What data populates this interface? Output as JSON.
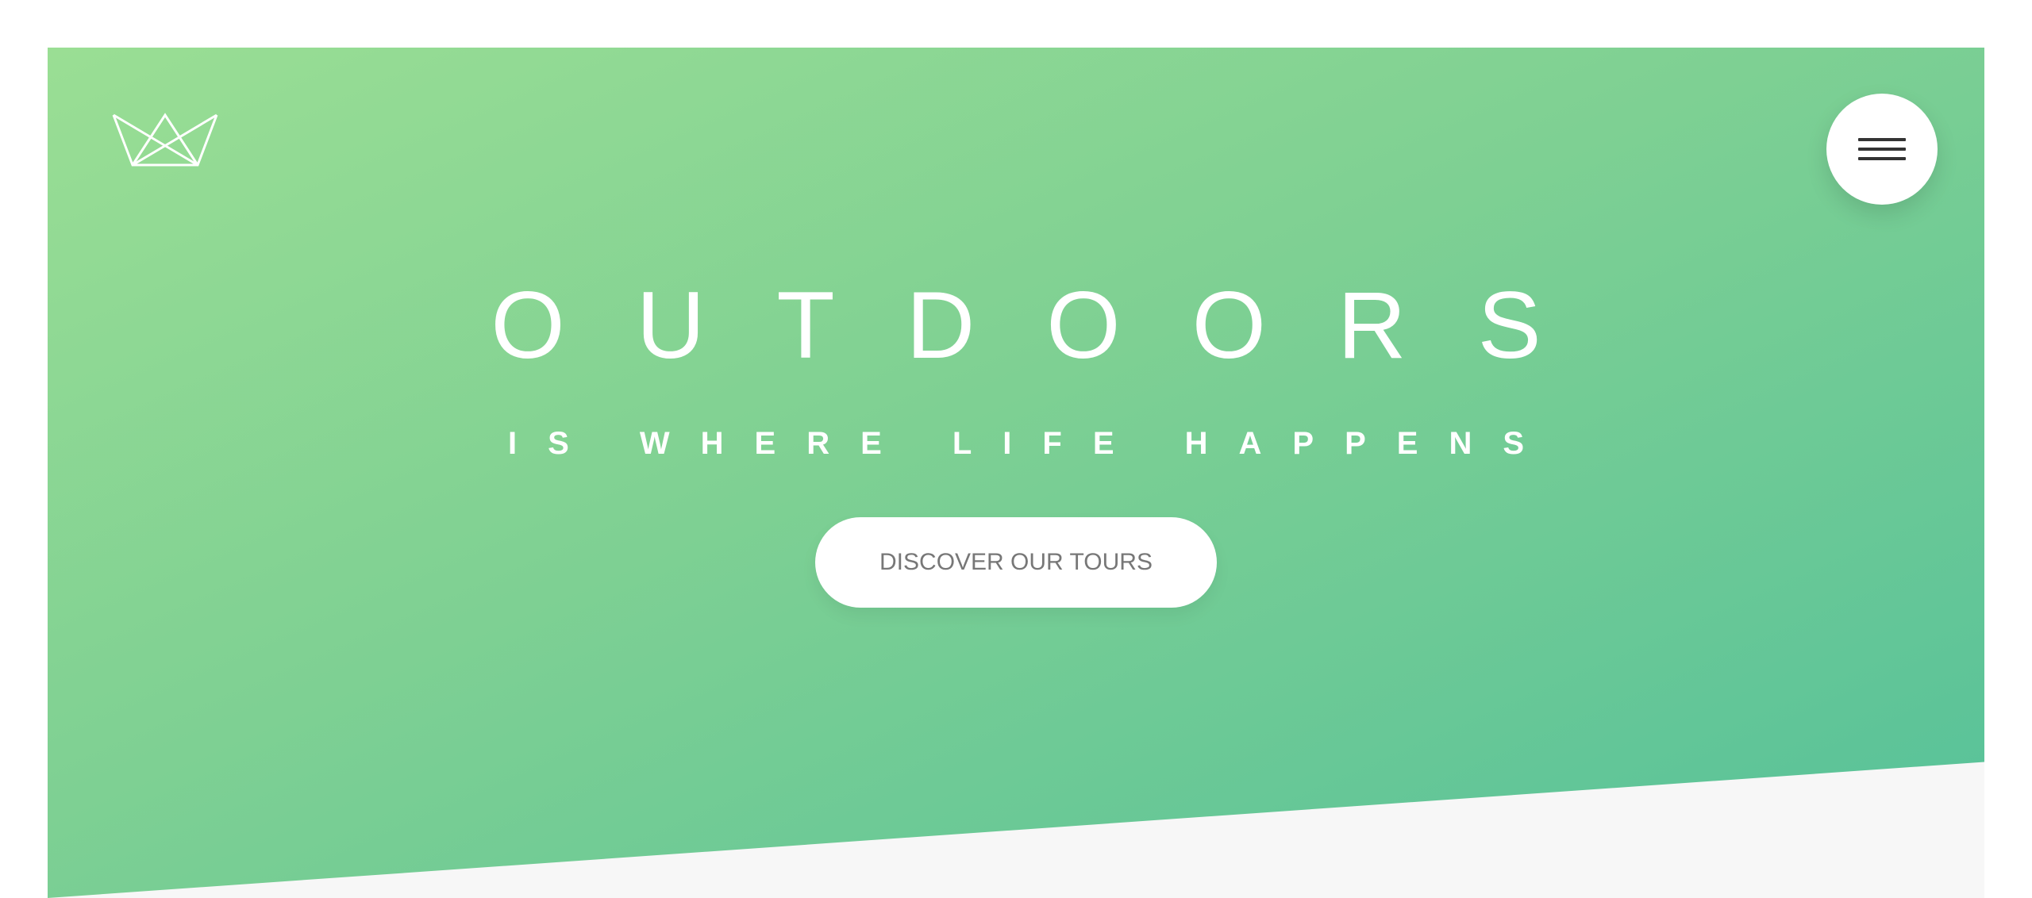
{
  "header": {
    "logo_icon": "crown-icon",
    "menu_icon": "hamburger-menu-icon"
  },
  "hero": {
    "title": "OUTDOORS",
    "subtitle": "IS WHERE LIFE HAPPENS",
    "cta_label": "DISCOVER OUR TOURS"
  },
  "colors": {
    "gradient_start": "#9ade94",
    "gradient_end": "#55c19a",
    "text_light": "#ffffff",
    "button_text": "#777777",
    "section_below": "#f7f7f7"
  }
}
